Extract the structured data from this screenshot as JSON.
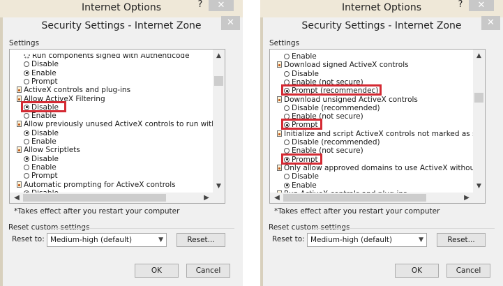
{
  "outer_title": "Internet Options",
  "help_glyph": "?",
  "close_glyph": "✕",
  "dialog_title": "Security Settings - Internet Zone",
  "settings_label": "Settings",
  "note": "*Takes effect after you restart your computer",
  "reset_group_label": "Reset custom settings",
  "reset_to_label": "Reset to:",
  "reset_level": "Medium-high (default)",
  "reset_button": "Reset...",
  "ok_button": "OK",
  "cancel_button": "Cancel",
  "highlight_color": "#d42a33",
  "left_list": [
    {
      "type": "gear",
      "label": "Run components signed with Authenticode",
      "partial": "top"
    },
    {
      "type": "radio",
      "label": "Disable",
      "checked": false
    },
    {
      "type": "radio",
      "label": "Enable",
      "checked": true
    },
    {
      "type": "radio",
      "label": "Prompt",
      "checked": false
    },
    {
      "type": "category",
      "label": "ActiveX controls and plug-ins"
    },
    {
      "type": "category",
      "label": "Allow ActiveX Filtering"
    },
    {
      "type": "radio",
      "label": "Disable",
      "checked": true,
      "highlighted": true
    },
    {
      "type": "radio",
      "label": "Enable",
      "checked": false
    },
    {
      "type": "category",
      "label": "Allow previously unused ActiveX controls to run without prompt"
    },
    {
      "type": "radio",
      "label": "Disable",
      "checked": true
    },
    {
      "type": "radio",
      "label": "Enable",
      "checked": false
    },
    {
      "type": "category",
      "label": "Allow Scriptlets"
    },
    {
      "type": "radio",
      "label": "Disable",
      "checked": true
    },
    {
      "type": "radio",
      "label": "Enable",
      "checked": false
    },
    {
      "type": "radio",
      "label": "Prompt",
      "checked": false
    },
    {
      "type": "category",
      "label": "Automatic prompting for ActiveX controls"
    },
    {
      "type": "radio",
      "label": "Disable",
      "checked": true,
      "partial": "bottom"
    }
  ],
  "right_list": [
    {
      "type": "radio",
      "label": "Enable",
      "checked": false
    },
    {
      "type": "category",
      "label": "Download signed ActiveX controls"
    },
    {
      "type": "radio",
      "label": "Disable",
      "checked": false
    },
    {
      "type": "radio",
      "label": "Enable (not secure)",
      "checked": false
    },
    {
      "type": "radio",
      "label": "Prompt (recommendec)",
      "checked": true,
      "highlighted": true
    },
    {
      "type": "category",
      "label": "Download unsigned ActiveX controls"
    },
    {
      "type": "radio",
      "label": "Disable (recommended)",
      "checked": false
    },
    {
      "type": "radio",
      "label": "Enable (not secure)",
      "checked": false
    },
    {
      "type": "radio",
      "label": "Prompt",
      "checked": true,
      "highlighted": true
    },
    {
      "type": "category",
      "label": "Initialize and script ActiveX controls not marked as safe for script"
    },
    {
      "type": "radio",
      "label": "Disable (recommended)",
      "checked": false
    },
    {
      "type": "radio",
      "label": "Enable (not secure)",
      "checked": false
    },
    {
      "type": "radio",
      "label": "Prompt",
      "checked": true,
      "highlighted": true
    },
    {
      "type": "category",
      "label": "Only allow approved domains to use ActiveX without prompt"
    },
    {
      "type": "radio",
      "label": "Disable",
      "checked": false
    },
    {
      "type": "radio",
      "label": "Enable",
      "checked": true
    },
    {
      "type": "category",
      "label": "Run ActiveX controls and plug-ins",
      "partial": "bottom"
    }
  ]
}
